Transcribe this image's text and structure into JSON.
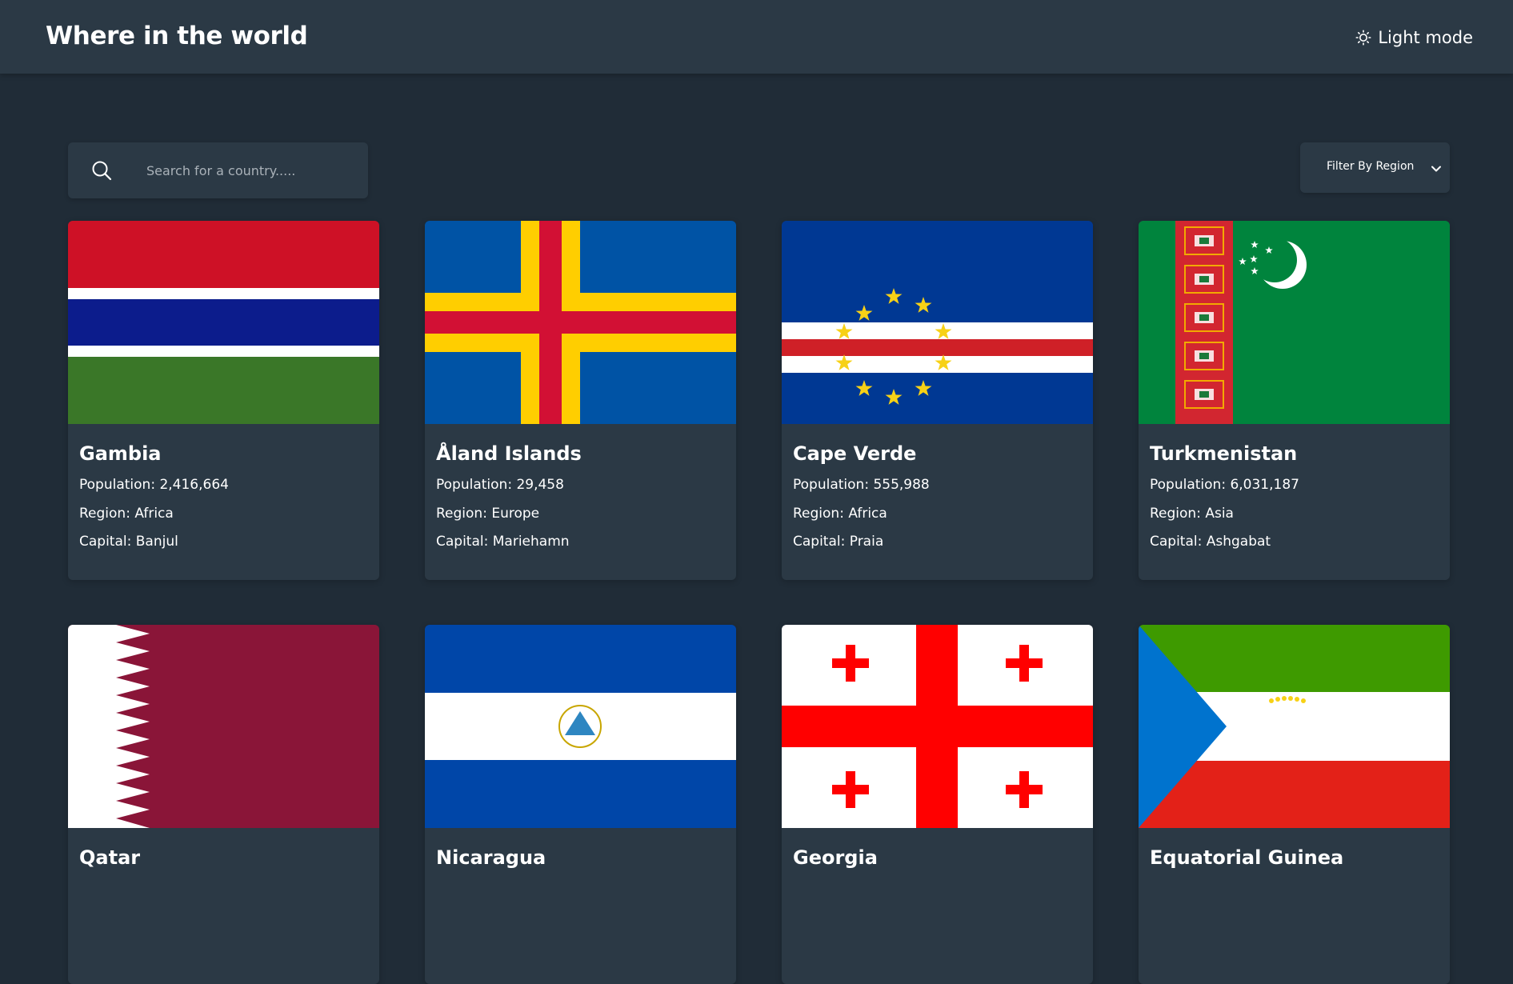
{
  "header": {
    "title": "Where in the world",
    "theme_toggle_label": "Light mode",
    "theme_toggle_icon": "sun-icon"
  },
  "search": {
    "placeholder": "Search for a country.....",
    "value": "",
    "icon": "search-icon"
  },
  "filter": {
    "label": "Filter By Region",
    "icon": "chevron-down-icon"
  },
  "colors": {
    "background": "#202c37",
    "surface": "#2b3945",
    "text": "#ffffff"
  },
  "countries": [
    {
      "name": "Gambia",
      "population": "Population: 2,416,664",
      "region": "Region: Africa",
      "capital": "Capital: Banjul"
    },
    {
      "name": "Åland Islands",
      "population": "Population: 29,458",
      "region": "Region: Europe",
      "capital": "Capital: Mariehamn"
    },
    {
      "name": "Cape Verde",
      "population": "Population: 555,988",
      "region": "Region: Africa",
      "capital": "Capital: Praia"
    },
    {
      "name": "Turkmenistan",
      "population": "Population: 6,031,187",
      "region": "Region: Asia",
      "capital": "Capital: Ashgabat"
    },
    {
      "name": "Qatar"
    },
    {
      "name": "Nicaragua"
    },
    {
      "name": "Georgia"
    },
    {
      "name": "Equatorial Guinea"
    }
  ]
}
